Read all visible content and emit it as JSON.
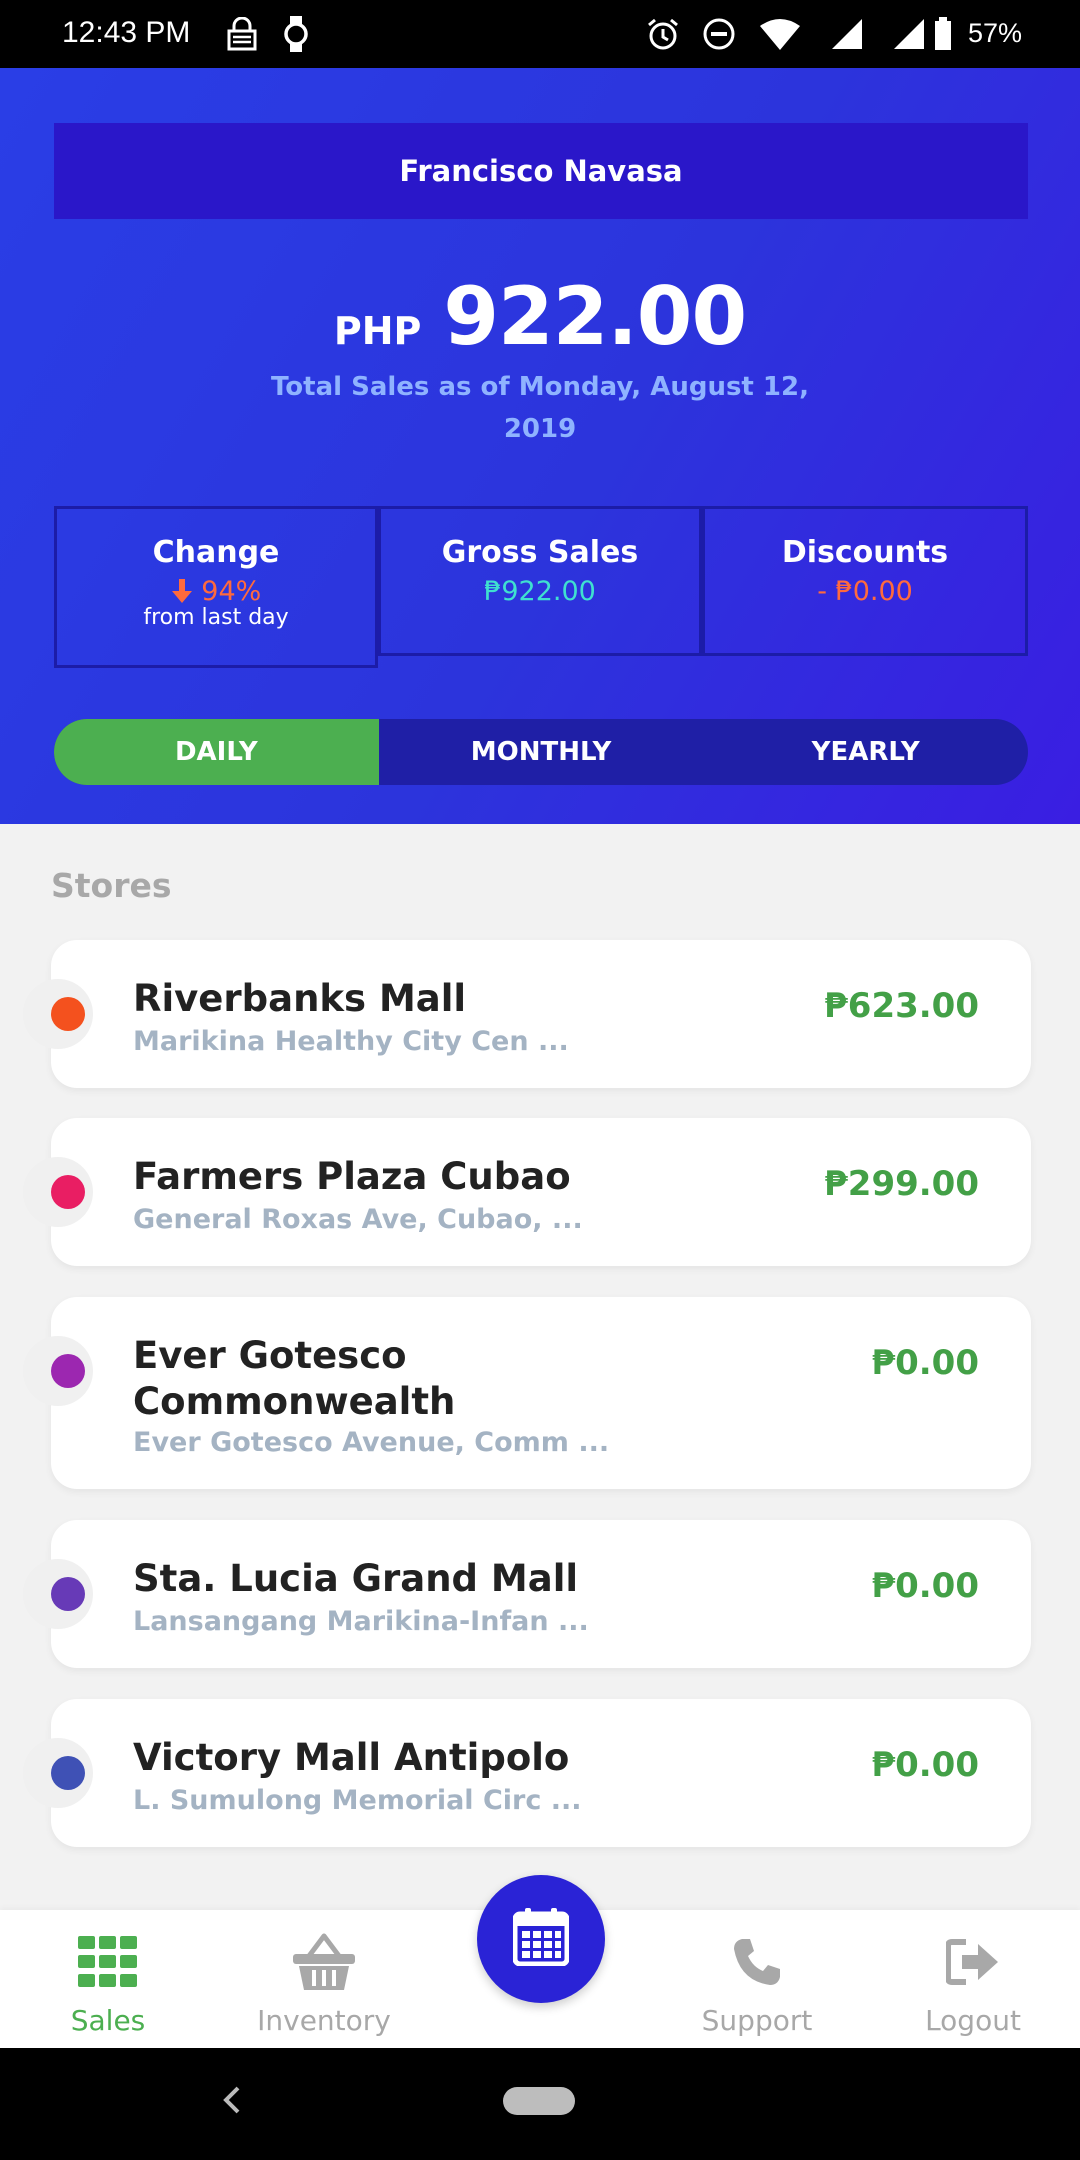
{
  "status_bar": {
    "time": "12:43 PM",
    "battery": "57%"
  },
  "header": {
    "user_name": "Francisco Navasa",
    "currency": "PHP",
    "total_amount": "922.00",
    "total_caption": "Total Sales as of Monday, August 12, 2019"
  },
  "stats": {
    "change": {
      "label": "Change",
      "value": "94%",
      "sub": "from last day",
      "direction": "down",
      "color": "#ff6a3d"
    },
    "gross": {
      "label": "Gross Sales",
      "value": "₱922.00",
      "color": "#3fe0d0"
    },
    "discounts": {
      "label": "Discounts",
      "value": "- ₱0.00",
      "color": "#ff6a3d"
    }
  },
  "period_tabs": [
    {
      "label": "DAILY",
      "active": true
    },
    {
      "label": "MONTHLY",
      "active": false
    },
    {
      "label": "YEARLY",
      "active": false
    }
  ],
  "stores_heading": "Stores",
  "stores": [
    {
      "name": "Riverbanks Mall",
      "address": "Marikina Healthy City Cen ...",
      "amount": "₱623.00",
      "color": "#f4511e"
    },
    {
      "name": "Farmers Plaza Cubao",
      "address": "General Roxas Ave, Cubao, ...",
      "amount": "₱299.00",
      "color": "#e91e63"
    },
    {
      "name": "Ever Gotesco Commonwealth",
      "address": "Ever Gotesco Avenue, Comm ...",
      "amount": "₱0.00",
      "color": "#9c27b0"
    },
    {
      "name": "Sta. Lucia Grand Mall",
      "address": "Lansangang Marikina-Infan ...",
      "amount": "₱0.00",
      "color": "#673ab7"
    },
    {
      "name": "Victory Mall Antipolo",
      "address": "L. Sumulong Memorial Circ ...",
      "amount": "₱0.00",
      "color": "#3f51b5"
    }
  ],
  "bottom_nav": {
    "sales": "Sales",
    "inventory": "Inventory",
    "support": "Support",
    "logout": "Logout"
  },
  "icons": {
    "fab": "calendar-icon",
    "sales": "grid-icon",
    "inventory": "basket-icon",
    "support": "phone-icon",
    "logout": "logout-icon"
  }
}
